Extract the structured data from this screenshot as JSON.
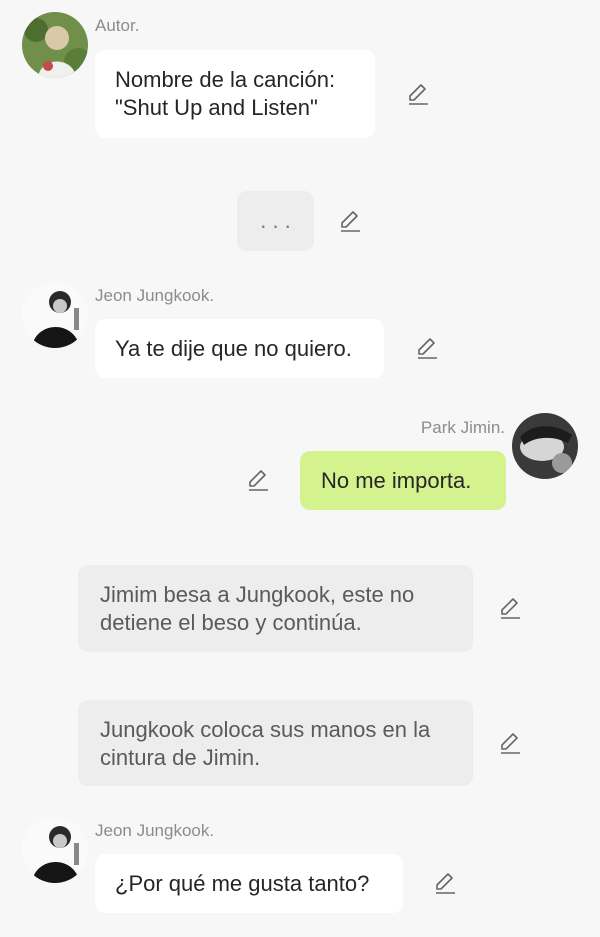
{
  "messages": [
    {
      "type": "chat",
      "side": "left",
      "speaker": "Autor.",
      "avatar": "author-avatar",
      "text": "Nombre de la canción: \"Shut Up and Listen\""
    },
    {
      "type": "narration",
      "text": ". . ."
    },
    {
      "type": "chat",
      "side": "left",
      "speaker": "Jeon Jungkook.",
      "avatar": "jungkook-avatar",
      "text": "Ya te dije que no quiero."
    },
    {
      "type": "chat",
      "side": "right",
      "speaker": "Park Jimin.",
      "avatar": "jimin-avatar",
      "text": "No me importa."
    },
    {
      "type": "narration",
      "text": "Jimim besa a Jungkook, este no detiene el beso y continúa."
    },
    {
      "type": "narration",
      "text": "Jungkook coloca sus manos en la cintura de Jimin."
    },
    {
      "type": "chat",
      "side": "left",
      "speaker": "Jeon Jungkook.",
      "avatar": "jungkook-avatar",
      "text": "¿Por qué me gusta tanto?"
    }
  ],
  "icons": {
    "edit": "pencil-edit-icon"
  },
  "colors": {
    "background": "#f7f7f7",
    "bubble_left": "#ffffff",
    "bubble_right": "#d4f38e",
    "narration": "#ededed",
    "speaker_name": "#8c8c8c"
  }
}
